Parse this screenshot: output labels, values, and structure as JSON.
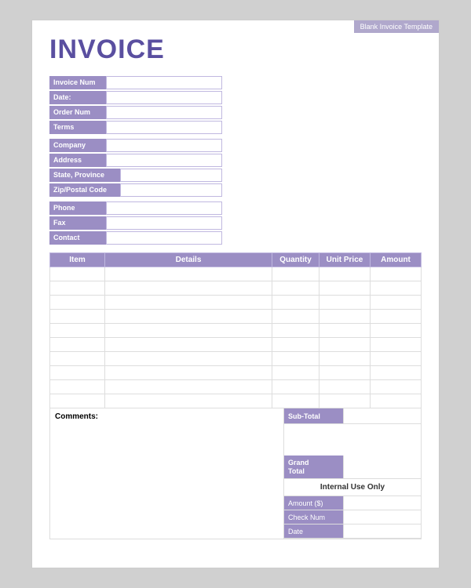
{
  "template": {
    "label": "Blank Invoice Template"
  },
  "header": {
    "title": "INVOICE"
  },
  "info_fields": {
    "invoice_num_label": "Invoice Num",
    "date_label": "Date:",
    "order_num_label": "Order Num",
    "terms_label": "Terms"
  },
  "company_fields": {
    "company_label": "Company",
    "address_label": "Address",
    "state_label": "State, Province",
    "zip_label": "Zip/Postal Code"
  },
  "contact_fields": {
    "phone_label": "Phone",
    "fax_label": "Fax",
    "contact_label": "Contact"
  },
  "table": {
    "headers": {
      "item": "Item",
      "details": "Details",
      "quantity": "Quantity",
      "unit_price": "Unit Price",
      "amount": "Amount"
    },
    "rows": 10
  },
  "comments": {
    "label": "Comments:"
  },
  "totals": {
    "sub_total_label": "Sub-Total",
    "grand_total_label": "Grand\nTotal",
    "internal_use": "Internal Use Only",
    "amount_label": "Amount ($)",
    "check_num_label": "Check Num",
    "date_label": "Date"
  }
}
